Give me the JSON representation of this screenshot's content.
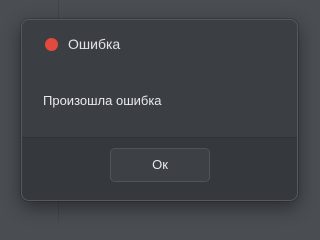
{
  "dialog": {
    "title": "Ошибка",
    "status_icon": "error-dot-icon",
    "status_color": "#e24a3d",
    "message": "Произошла ошибка",
    "ok_label": "Ок"
  }
}
